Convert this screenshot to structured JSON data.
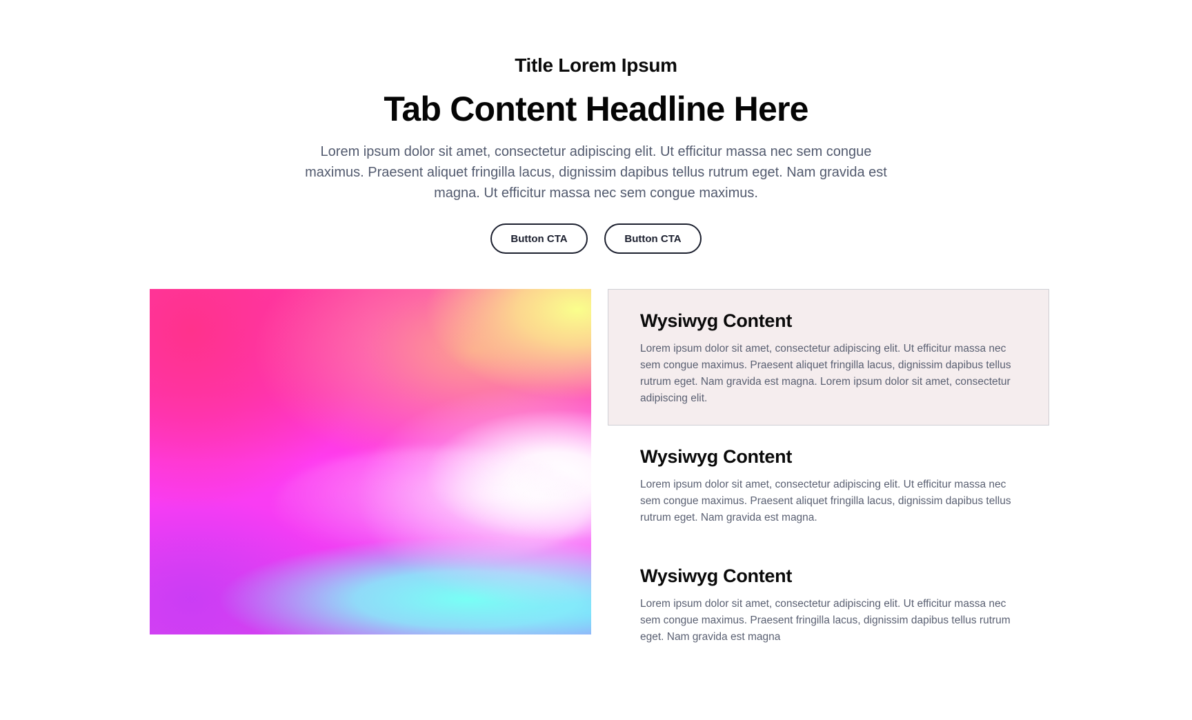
{
  "hero": {
    "eyebrow": "Title Lorem Ipsum",
    "headline": "Tab Content Headline Here",
    "intro": "Lorem ipsum dolor sit amet, consectetur adipiscing elit. Ut efficitur massa nec sem congue maximus. Praesent aliquet fringilla lacus, dignissim dapibus tellus rutrum eget. Nam gravida est magna. Ut efficitur massa nec sem congue maximus.",
    "cta_primary": "Button CTA",
    "cta_secondary": "Button CTA"
  },
  "media": {
    "image_description_icon": "gradient-image"
  },
  "tabs": [
    {
      "title": "Wysiwyg Content",
      "body": "Lorem ipsum dolor sit amet, consectetur adipiscing elit. Ut efficitur massa nec sem congue maximus. Praesent aliquet fringilla lacus, dignissim dapibus tellus rutrum eget. Nam gravida est magna. Lorem ipsum dolor sit amet, consectetur adipiscing elit.",
      "active": true
    },
    {
      "title": "Wysiwyg Content",
      "body": "Lorem ipsum dolor sit amet, consectetur adipiscing elit. Ut efficitur massa nec sem congue maximus. Praesent aliquet fringilla lacus, dignissim dapibus tellus rutrum eget. Nam gravida est magna.",
      "active": false
    },
    {
      "title": "Wysiwyg Content",
      "body": "Lorem ipsum dolor sit amet, consectetur adipiscing elit. Ut efficitur massa nec sem congue maximus. Praesent  fringilla lacus, dignissim dapibus tellus rutrum eget. Nam gravida est magna",
      "active": false
    }
  ],
  "colors": {
    "text_primary": "#050505",
    "text_body": "#525a6e",
    "active_tab_bg": "#f5edee",
    "active_tab_border": "#cfcfd4",
    "button_border": "#1b1f2e"
  }
}
